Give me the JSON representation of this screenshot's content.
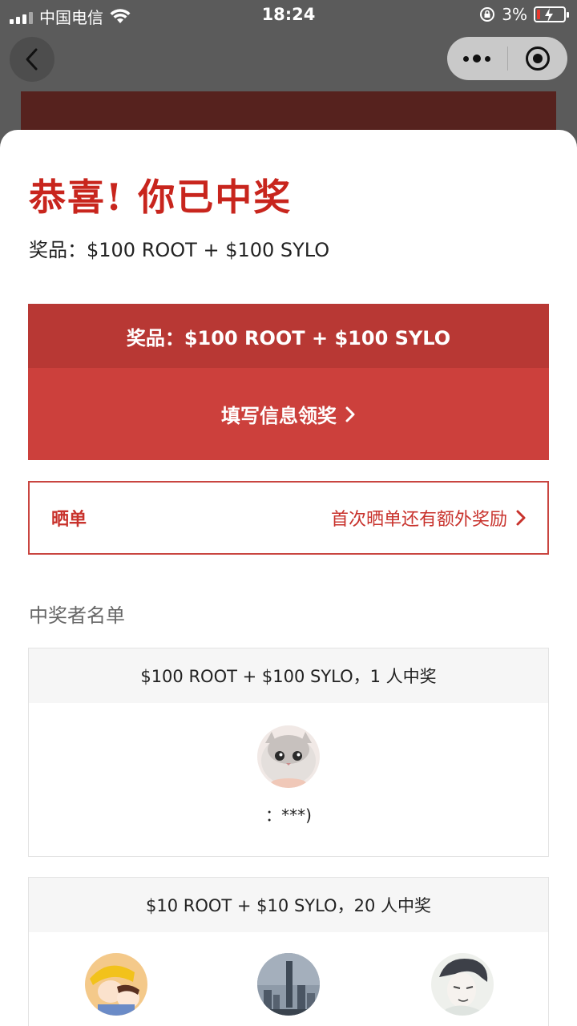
{
  "status_bar": {
    "carrier": "中国电信",
    "time": "18:24",
    "battery_percent": "3%",
    "battery_level": 0.03,
    "battery_color": "#e8392e"
  },
  "nav": {
    "back_icon": "chevron-left-icon",
    "more_icon": "more-dots-icon",
    "close_icon": "target-icon"
  },
  "result": {
    "title": "恭喜! 你已中奖",
    "prize_line": "奖品：$100 ROOT + $100 SYLO"
  },
  "claim": {
    "prize_label": "奖品：$100 ROOT + $100 SYLO",
    "button_label": "填写信息领奖"
  },
  "share": {
    "label": "晒单",
    "hint": "首次晒单还有额外奖励"
  },
  "winners": {
    "title": "中奖者名单",
    "groups": [
      {
        "header": "$100 ROOT + $100 SYLO，1 人中奖",
        "winners": [
          {
            "name": "：***)",
            "avatar": "cat-avatar"
          }
        ]
      },
      {
        "header": "$10 ROOT + $10 SYLO，20 人中奖",
        "winners": [
          {
            "avatar": "anime-kids-avatar"
          },
          {
            "avatar": "city-skyline-avatar"
          },
          {
            "avatar": "sketch-person-avatar"
          }
        ]
      }
    ]
  },
  "colors": {
    "brand_red": "#c8251d",
    "claim_top": "#b83834",
    "claim_button": "#cc403c"
  }
}
